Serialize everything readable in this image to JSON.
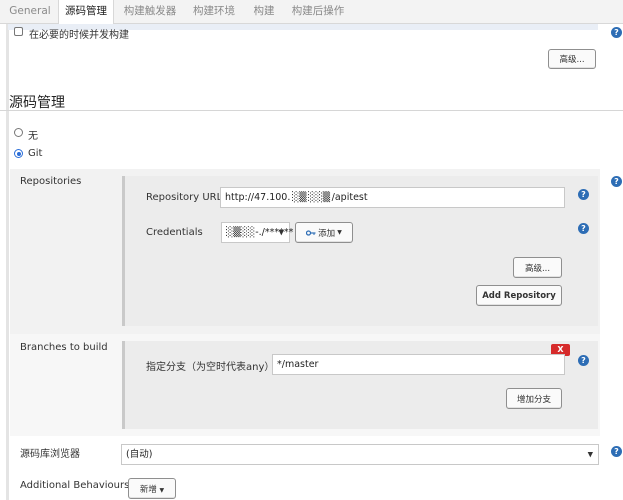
{
  "tabs": [
    {
      "label": "General"
    },
    {
      "label": "源码管理"
    },
    {
      "label": "构建触发器"
    },
    {
      "label": "构建环境"
    },
    {
      "label": "构建"
    },
    {
      "label": "构建后操作"
    }
  ],
  "general": {
    "concurrent_build_label": "在必要的时候并发构建",
    "advanced_button": "高级..."
  },
  "scm": {
    "title": "源码管理",
    "options": [
      {
        "label": "无",
        "selected": false
      },
      {
        "label": "Git",
        "selected": true
      }
    ]
  },
  "repositories": {
    "label": "Repositories",
    "url_label": "Repository URL",
    "url_value": "http://47.100. ░▒ ░░▒ /apitest",
    "credentials_label": "Credentials",
    "credentials_value": "░▒░░-./******",
    "add_button": "添加",
    "advanced_button": "高级...",
    "add_repository_button": "Add Repository"
  },
  "branches": {
    "label": "Branches to build",
    "branch_label": "指定分支（为空时代表any）",
    "branch_value": "*/master",
    "delete_button": "X",
    "add_branch_button": "增加分支"
  },
  "browser": {
    "label": "源码库浏览器",
    "selected": "(自动)"
  },
  "behaviours": {
    "label": "Additional Behaviours",
    "add_button": "新增"
  },
  "icons": {
    "help": "?",
    "caret": "▼"
  },
  "colors": {
    "help_icon": "#2d6db5",
    "delete_button": "#d62b2b",
    "radio_selected": "#2b6ed8"
  }
}
